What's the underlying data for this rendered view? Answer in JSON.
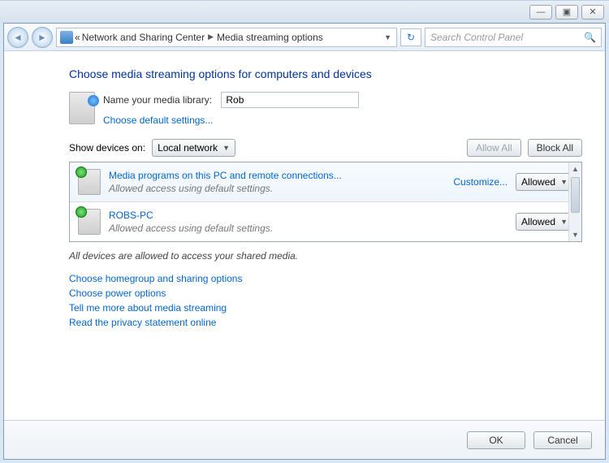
{
  "titlebar": {
    "min": "—",
    "max": "▣",
    "close": "✕"
  },
  "nav": {
    "back_prefix": "«",
    "crumb1": "Network and Sharing Center",
    "crumb2": "Media streaming options",
    "search_placeholder": "Search Control Panel"
  },
  "page": {
    "heading": "Choose media streaming options for computers and devices",
    "library_label": "Name your media library:",
    "library_value": "Rob",
    "defaults_link": "Choose default settings...",
    "show_devices_label": "Show devices on:",
    "show_devices_value": "Local network",
    "allow_all": "Allow All",
    "block_all": "Block All",
    "status": "All devices are allowed to access your shared media.",
    "links": {
      "l1": "Choose homegroup and sharing options",
      "l2": "Choose power options",
      "l3": "Tell me more about media streaming",
      "l4": "Read the privacy statement online"
    }
  },
  "devices": {
    "d1": {
      "title": "Media programs on this PC and remote connections...",
      "sub": "Allowed access using default settings.",
      "customize": "Customize...",
      "perm": "Allowed"
    },
    "d2": {
      "title": "ROBS-PC",
      "sub": "Allowed access using default settings.",
      "perm": "Allowed"
    }
  },
  "footer": {
    "ok": "OK",
    "cancel": "Cancel"
  }
}
